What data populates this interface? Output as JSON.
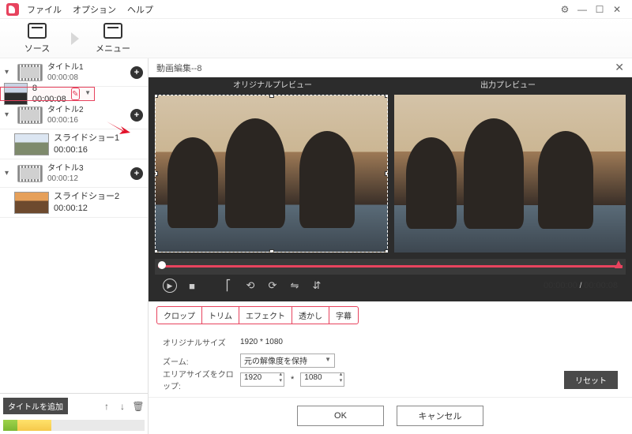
{
  "menu": {
    "file": "ファイル",
    "option": "オプション",
    "help": "ヘルプ"
  },
  "win": {
    "settings": "⚙",
    "min": "—",
    "max": "☐",
    "close": "✕"
  },
  "tabs": {
    "source": "ソース",
    "menu": "メニュー"
  },
  "sidebar": {
    "titles": [
      {
        "name": "タイトル1",
        "dur": "00:00:08",
        "clips": [
          {
            "name": "8",
            "dur": "00:00:08",
            "selected": true
          }
        ]
      },
      {
        "name": "タイトル2",
        "dur": "00:00:16",
        "clips": [
          {
            "name": "スライドショー1",
            "dur": "00:00:16"
          }
        ]
      },
      {
        "name": "タイトル3",
        "dur": "00:00:12",
        "clips": [
          {
            "name": "スライドショー2",
            "dur": "00:00:12"
          }
        ]
      }
    ],
    "add_title": "タイトルを追加"
  },
  "editor": {
    "title": "動画編集--8",
    "preview": {
      "original": "オリジナルプレビュー",
      "output": "出力プレビュー"
    },
    "time": {
      "current": "00:00:00",
      "total": "00:00:08"
    },
    "tabs": {
      "crop": "クロップ",
      "trim": "トリム",
      "effect": "エフェクト",
      "watermark": "透かし",
      "subtitle": "字幕"
    },
    "crop": {
      "orig_label": "オリジナルサイズ",
      "orig_value": "1920 * 1080",
      "zoom_label": "ズーム:",
      "zoom_value": "元の解像度を保持",
      "area_label": "エリアサイズをクロップ:",
      "w": "1920",
      "h": "1080",
      "mul": "*",
      "reset": "リセット"
    },
    "buttons": {
      "ok": "OK",
      "cancel": "キャンセル"
    }
  }
}
